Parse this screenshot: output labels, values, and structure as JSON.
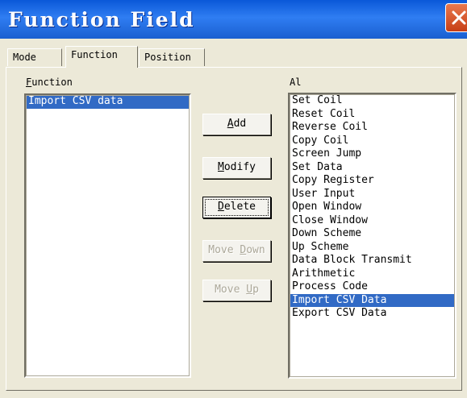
{
  "window": {
    "title": "Function Field"
  },
  "tabs": [
    {
      "label": "Mode"
    },
    {
      "label": "Function"
    },
    {
      "label": "Position"
    }
  ],
  "function_list": {
    "label": "Function",
    "items": [
      "Import CSV data"
    ],
    "selected_index": 0
  },
  "buttons": {
    "add": "Add",
    "modify": "Modify",
    "delete": "Delete",
    "move_down": "Move Down",
    "move_up": "Move Up"
  },
  "available_list": {
    "label": "Al",
    "items": [
      "Set Coil",
      "Reset Coil",
      "Reverse Coil",
      "Copy Coil",
      "Screen Jump",
      "Set Data",
      "Copy Register",
      "User Input",
      "Open Window",
      "Close Window",
      "Down Scheme",
      "Up Scheme",
      "Data Block Transmit",
      "Arithmetic",
      "Process Code",
      "Import CSV Data",
      "Export CSV Data"
    ],
    "selected_index": 15
  },
  "colors": {
    "selection": "#316ac5",
    "titlebar": "#0a58d8",
    "close": "#c73e16"
  }
}
